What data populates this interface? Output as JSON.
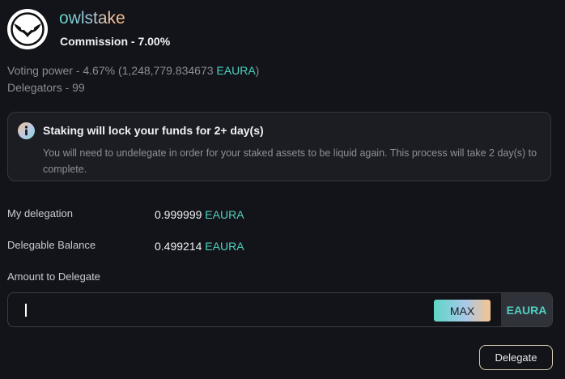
{
  "validator": {
    "name": "owlstake",
    "commission": "Commission - 7.00%",
    "logo_icon": "owl-logo-icon"
  },
  "stats": {
    "voting_power_prefix": "Voting power - 4.67%  (1,248,779.834673 ",
    "voting_power_unit": "EAURA",
    "voting_power_suffix": ")",
    "delegators": "Delegators - 99"
  },
  "notice": {
    "icon": "info-icon",
    "title": "Staking will lock your funds for 2+ day(s)",
    "body": "You will need to undelegate in order for your staked assets to be liquid again. This process will take 2 day(s) to complete."
  },
  "my_delegation": {
    "label": "My delegation",
    "amount": "0.999999",
    "unit": "EAURA"
  },
  "delegable_balance": {
    "label": "Delegable Balance",
    "amount": "0.499214",
    "unit": "EAURA"
  },
  "amount_input": {
    "label": "Amount to Delegate",
    "value": "",
    "placeholder": "",
    "max_label": "MAX",
    "unit": "EAURA"
  },
  "actions": {
    "delegate_label": "Delegate"
  },
  "colors": {
    "accent": "#4fd0c0",
    "background": "#131419",
    "panel": "#1c1d22"
  }
}
